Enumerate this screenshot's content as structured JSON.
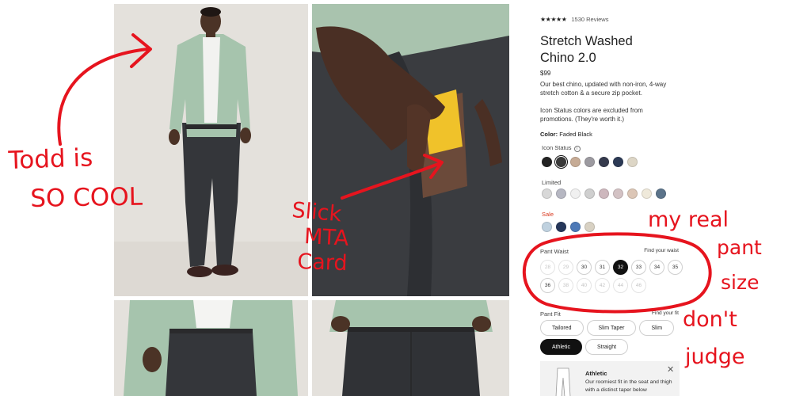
{
  "product": {
    "rating_stars": "★★★★★",
    "review_count": "1530 Reviews",
    "title_line1": "Stretch Washed",
    "title_line2": "Chino 2.0",
    "price": "$99",
    "description": "Our best chino, updated with non-iron, 4-way stretch cotton & a secure zip pocket.",
    "status_note": "Icon Status colors are excluded from promotions. (They're worth it.)",
    "color_label": "Color:",
    "color_value": "Faded Black"
  },
  "swatch_groups": {
    "icon_status": {
      "label": "Icon Status",
      "colors": [
        "#232323",
        "#3a3a3a",
        "#c6ab95",
        "#9c9aa0",
        "#353a4d",
        "#2c3a55",
        "#ddd6c6"
      ],
      "selected_index": 1
    },
    "limited": {
      "label": "Limited",
      "colors": [
        "#d8d8d8",
        "#b6b7c2",
        "#f0f0f0",
        "#cfcfcf",
        "#cdb7bd",
        "#d3c2c4",
        "#dcc6b6",
        "#efe9da",
        "#5b738a"
      ],
      "striped_index": 0
    },
    "sale": {
      "label": "Sale",
      "colors": [
        "#bfd1df",
        "#26375a",
        "#4d79b7",
        "#d8d1c3"
      ]
    }
  },
  "pant_waist": {
    "label": "Pant Waist",
    "find_link": "Find your waist",
    "sizes": [
      {
        "value": "28",
        "state": "unavailable"
      },
      {
        "value": "29",
        "state": "unavailable"
      },
      {
        "value": "30",
        "state": "available"
      },
      {
        "value": "31",
        "state": "available"
      },
      {
        "value": "32",
        "state": "selected"
      },
      {
        "value": "33",
        "state": "available"
      },
      {
        "value": "34",
        "state": "available"
      },
      {
        "value": "35",
        "state": "available"
      },
      {
        "value": "36",
        "state": "available"
      },
      {
        "value": "38",
        "state": "unavailable"
      },
      {
        "value": "40",
        "state": "unavailable"
      },
      {
        "value": "42",
        "state": "unavailable"
      },
      {
        "value": "44",
        "state": "unavailable"
      },
      {
        "value": "46",
        "state": "unavailable"
      }
    ]
  },
  "pant_fit": {
    "label": "Pant Fit",
    "find_link": "Find your fit",
    "options": [
      {
        "label": "Tailored",
        "selected": false
      },
      {
        "label": "Slim Taper",
        "selected": false
      },
      {
        "label": "Slim",
        "selected": false
      },
      {
        "label": "Athletic",
        "selected": true
      },
      {
        "label": "Straight",
        "selected": false
      }
    ],
    "card": {
      "title": "Athletic",
      "description": "Our roomiest fit in the seat and thigh with a distinct taper below",
      "close_symbol": "✕"
    }
  },
  "annotations": {
    "todd_line1": "Todd is",
    "todd_line2": "SO COOL",
    "mta_line1": "Slick",
    "mta_line2": "MTA",
    "mta_line3": "Card",
    "size_line1": "my real",
    "size_line2": "pant",
    "size_line3": "size",
    "size_line4": "don't",
    "size_line5": "judge",
    "ink_color": "#e6141e"
  }
}
